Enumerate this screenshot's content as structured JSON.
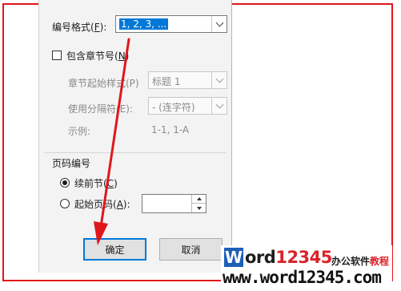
{
  "dialog": {
    "number_format": {
      "label": "编号格式(",
      "accel": "F",
      "label_end": "):",
      "value": "1, 2, 3, ..."
    },
    "include_chapter": {
      "label": "包含章节号(",
      "accel": "N",
      "label_end": ")",
      "checked": false
    },
    "chapter_style": {
      "label": "章节起始样式(P)",
      "value": "标题 1"
    },
    "separator": {
      "label": "使用分隔符(E):",
      "value": "-  (连字符)"
    },
    "example": {
      "label": "示例:",
      "value": "1-1, 1-A"
    },
    "page_numbering": {
      "title": "页码编号",
      "continue": {
        "label": "续前节(",
        "accel": "C",
        "label_end": ")",
        "selected": true
      },
      "start_at": {
        "label": "起始页码(",
        "accel": "A",
        "label_end": "):",
        "selected": false,
        "value": ""
      }
    },
    "ok_button": "确定",
    "cancel_button": "取消"
  },
  "annotation": {
    "color": "#e0161b"
  },
  "watermark": {
    "logo_letter": "W",
    "logo_text": "ord",
    "logo_number": "12345",
    "tagline_black": "办公软件",
    "tagline_red": "教程",
    "url": "www.word12345.com"
  }
}
